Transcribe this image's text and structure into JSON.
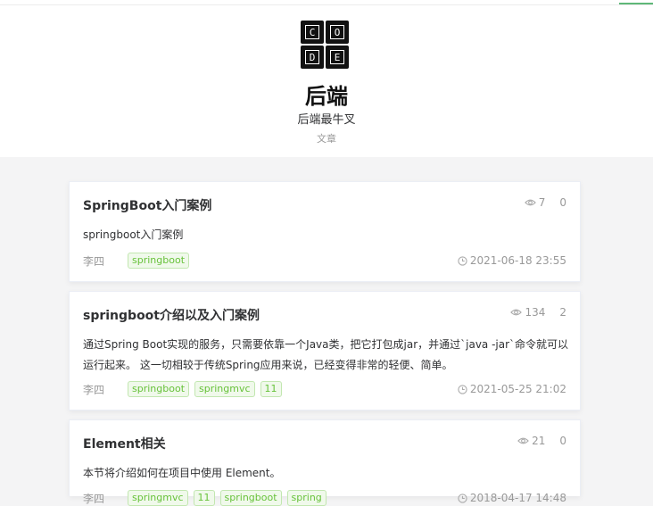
{
  "site": {
    "logo_letters": [
      "C",
      "O",
      "D",
      "E"
    ],
    "title": "后端",
    "subtitle": "后端最牛叉",
    "nav_label": "文章"
  },
  "articles": [
    {
      "title": "SpringBoot入门案例",
      "views": "7",
      "comments": "0",
      "summary": "springboot入门案例",
      "author": "李四",
      "tags": [
        "springboot"
      ],
      "date": "2021-06-18 23:55"
    },
    {
      "title": "springboot介绍以及入门案例",
      "views": "134",
      "comments": "2",
      "summary": "通过Spring Boot实现的服务，只需要依靠一个Java类，把它打包成jar，并通过`java -jar`命令就可以运行起来。 这一切相较于传统Spring应用来说，已经变得非常的轻便、简单。",
      "author": "李四",
      "tags": [
        "springboot",
        "springmvc",
        "11"
      ],
      "date": "2021-05-25 21:02"
    },
    {
      "title": "Element相关",
      "views": "21",
      "comments": "0",
      "summary": "本节将介绍如何在项目中使用 Element。",
      "author": "李四",
      "tags": [
        "springmvc",
        "11",
        "springboot",
        "spring"
      ],
      "date": "2018-04-17 14:48"
    }
  ],
  "colors": {
    "tag_green": "#67c23a",
    "accent": "#5fb878"
  },
  "icons": {
    "views": "eye-icon",
    "date": "clock-icon"
  }
}
